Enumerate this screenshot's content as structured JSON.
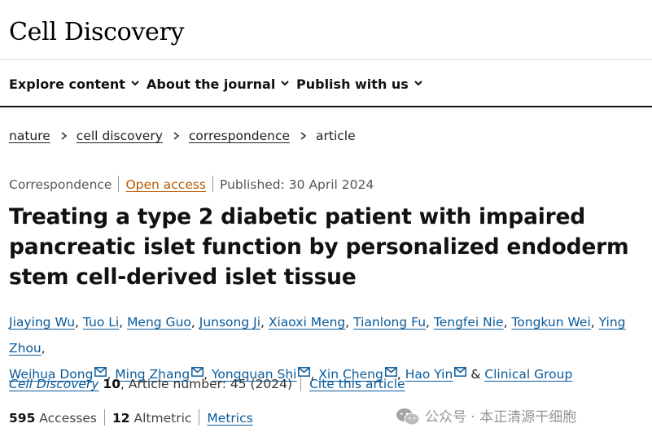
{
  "header": {
    "logo": "Cell Discovery"
  },
  "nav": {
    "items": [
      {
        "label": "Explore content"
      },
      {
        "label": "About the journal"
      },
      {
        "label": "Publish with us"
      }
    ]
  },
  "breadcrumb": [
    "nature",
    "cell discovery",
    "correspondence",
    "article"
  ],
  "meta": {
    "type": "Correspondence",
    "access": "Open access",
    "published": "Published: 30 April 2024"
  },
  "title": {
    "line1": "Treating a type 2 diabetic patient with impaired",
    "line2": "pancreatic islet function by personalized endoderm",
    "line3": "stem cell-derived islet tissue"
  },
  "authors": [
    "Jiaying Wu",
    "Tuo Li",
    "Meng Guo",
    "Junsong Ji",
    "Xiaoxi Meng",
    "Tianlong Fu",
    "Tengfei Nie",
    "Tongkun Wei",
    "Ying Zhou",
    "Weihua Dong",
    "Ming Zhang",
    "Yongquan Shi",
    "Xin Cheng",
    "Hao Yin"
  ],
  "authors_group_sep": "&",
  "authors_group": "Clinical Group",
  "citation": {
    "journal": "Cell Discovery",
    "volume": "10",
    "article": ", Article number: 45 (2024)",
    "cite_label": "Cite this article"
  },
  "metrics": {
    "accesses_count": "595",
    "accesses_label": "Accesses",
    "altmetric_count": "12",
    "altmetric_label": "Altmetric",
    "metrics_link": "Metrics"
  },
  "watermark": {
    "text": "公众号 · 本正清源干细胞"
  },
  "colors": {
    "link": "#0a5a9a",
    "open_access": "#b35900",
    "nav_border": "#111111"
  }
}
